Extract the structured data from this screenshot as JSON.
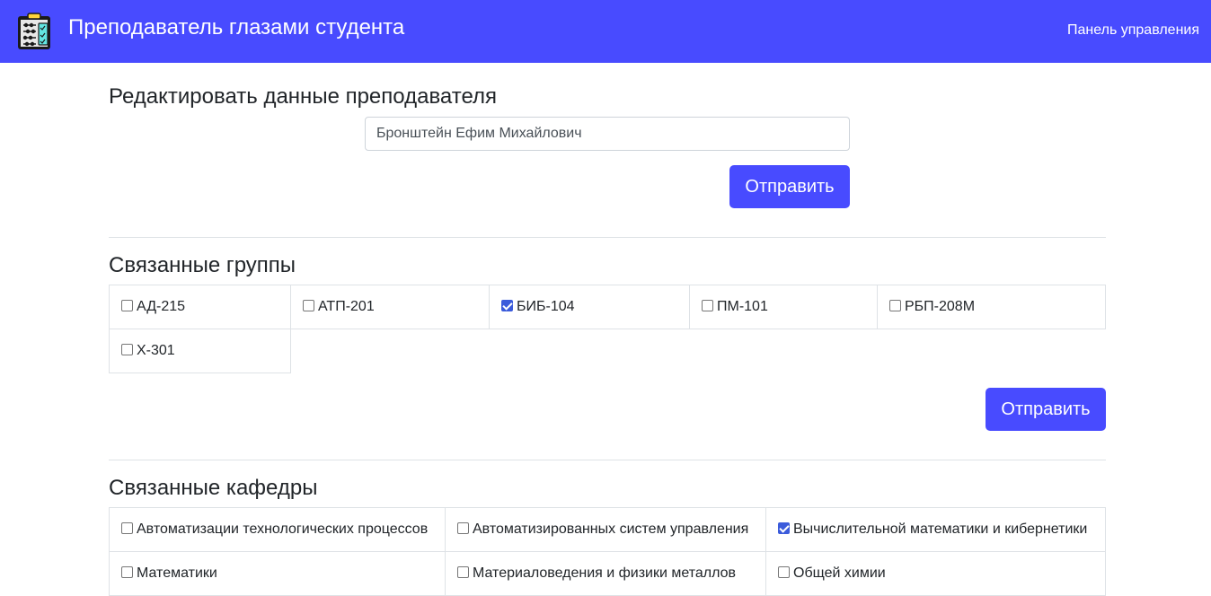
{
  "navbar": {
    "title": "Преподаватель глазами студента",
    "admin_link": "Панель управления",
    "logo_icon": "clipboard-abacus-icon"
  },
  "teacher_form": {
    "heading": "Редактировать данные преподавателя",
    "name_value": "Бронштейн Ефим Михайлович",
    "submit_label": "Отправить"
  },
  "groups": {
    "heading": "Связанные группы",
    "submit_label": "Отправить",
    "items": [
      {
        "label": "АД-215",
        "checked": false
      },
      {
        "label": "АТП-201",
        "checked": false
      },
      {
        "label": "БИБ-104",
        "checked": true
      },
      {
        "label": "ПМ-101",
        "checked": false
      },
      {
        "label": "РБП-208М",
        "checked": false
      },
      {
        "label": "Х-301",
        "checked": false
      }
    ]
  },
  "departments": {
    "heading": "Связанные кафедры",
    "items": [
      {
        "label": "Автоматизации технологических процессов",
        "checked": false
      },
      {
        "label": "Автоматизированных систем управления",
        "checked": false
      },
      {
        "label": "Вычислительной математики и кибернетики",
        "checked": true
      },
      {
        "label": "Математики",
        "checked": false
      },
      {
        "label": "Материаловедения и физики металлов",
        "checked": false
      },
      {
        "label": "Общей химии",
        "checked": false
      }
    ]
  },
  "colors": {
    "accent": "#484bff",
    "checkbox_checked": "#3b5bdb"
  }
}
